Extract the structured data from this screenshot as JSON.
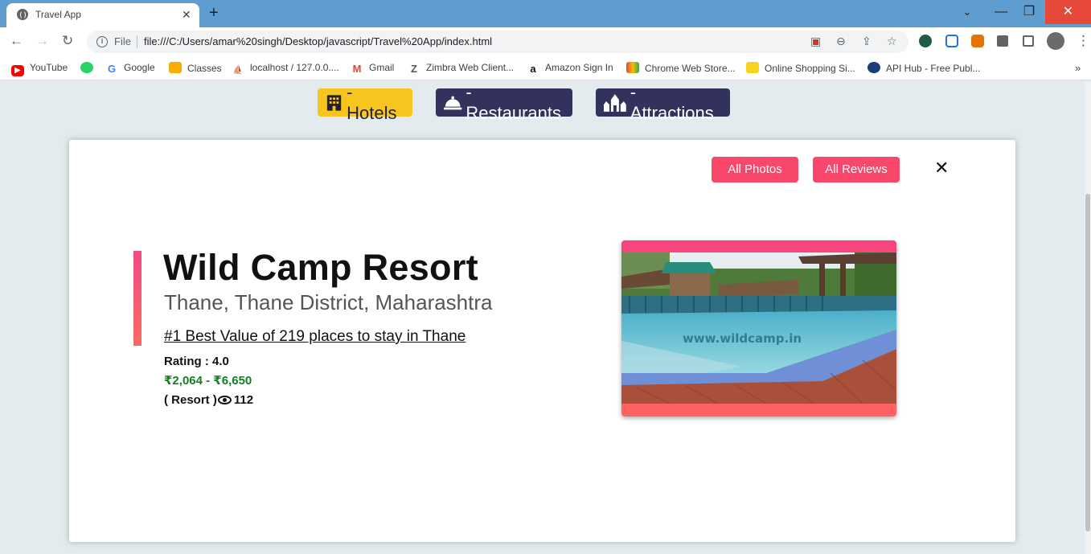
{
  "browser": {
    "tab_title": "Travel App",
    "tab_close": "✕",
    "new_tab": "+",
    "omnibox": {
      "scheme_label": "File",
      "url": "file:///C:/Users/amar%20singh/Desktop/javascript/Travel%20App/index.html"
    },
    "bookmarks": [
      {
        "label": "YouTube",
        "icon": "youtube-icon",
        "color": "#ff0000"
      },
      {
        "label": "",
        "icon": "whatsapp-icon",
        "color": "#25d366"
      },
      {
        "label": "Google",
        "icon": "google-icon",
        "color": "#4285f4"
      },
      {
        "label": "Classes",
        "icon": "classroom-icon",
        "color": "#f9ab00"
      },
      {
        "label": "localhost / 127.0.0....",
        "icon": "phpmyadmin-icon",
        "color": "#f29111"
      },
      {
        "label": "Gmail",
        "icon": "gmail-icon",
        "color": "#ea4335"
      },
      {
        "label": "Zimbra Web Client...",
        "icon": "zimbra-icon",
        "color": "#555555"
      },
      {
        "label": "Amazon Sign In",
        "icon": "amazon-icon",
        "color": "#111111"
      },
      {
        "label": "Chrome Web Store...",
        "icon": "chrome-store-icon",
        "color": "#4caf50"
      },
      {
        "label": "Online Shopping Si...",
        "icon": "flipkart-icon",
        "color": "#f7d21e"
      },
      {
        "label": "API Hub - Free Publ...",
        "icon": "apihub-icon",
        "color": "#1a3e7a"
      }
    ]
  },
  "categories": {
    "hotels": "- Hotels",
    "restaurants": "- Restaurants",
    "attractions": "- Attractions"
  },
  "detail": {
    "all_photos_label": "All Photos",
    "all_reviews_label": "All Reviews",
    "close_label": "✕",
    "name": "Wild Camp Resort",
    "location": "Thane, Thane District, Maharashtra",
    "ranking": "#1 Best Value of 219 places to stay in Thane",
    "rating_label": "Rating : 4.0",
    "price": "₹2,064 - ₹6,650",
    "type": "( Resort )",
    "views": "112",
    "photo_watermark": "www.wildcamp.in"
  },
  "colors": {
    "hotels_active": "#f7c51e",
    "category_inactive": "#32325c",
    "accent_pink": "#f9476b",
    "price_green": "#138022"
  }
}
